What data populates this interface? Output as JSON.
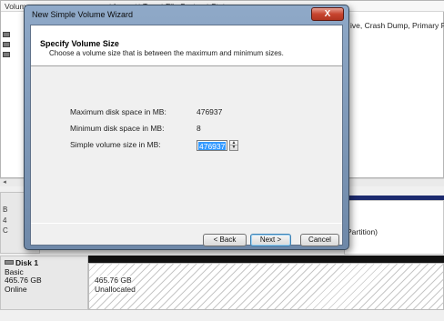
{
  "volume_list": {
    "headers": [
      "Volume",
      "Layout",
      "Type",
      "File System",
      "Status"
    ],
    "row_status": "ive, Crash Dump, Primary Partiti"
  },
  "disk0": {
    "label_fragments": [
      "B",
      "4",
      "C"
    ],
    "partition_text": "Partition)"
  },
  "disk1": {
    "name": "Disk 1",
    "type": "Basic",
    "size": "465.76 GB",
    "status": "Online",
    "partition_size": "465.76 GB",
    "partition_status": "Unallocated"
  },
  "wizard": {
    "title": "New Simple Volume Wizard",
    "close_glyph": "X",
    "heading": "Specify Volume Size",
    "subheading": "Choose a volume size that is between the maximum and minimum sizes.",
    "max_label": "Maximum disk space in MB:",
    "max_value": "476937",
    "min_label": "Minimum disk space in MB:",
    "min_value": "8",
    "size_label": "Simple volume size in MB:",
    "size_value": "476937",
    "buttons": {
      "back": "< Back",
      "next": "Next >",
      "cancel": "Cancel"
    }
  },
  "colors": {
    "selection": "#3399ff",
    "close_button": "#c7442e",
    "disk_bar_primary": "#1c2a6e",
    "unallocated_bar": "#111111"
  }
}
